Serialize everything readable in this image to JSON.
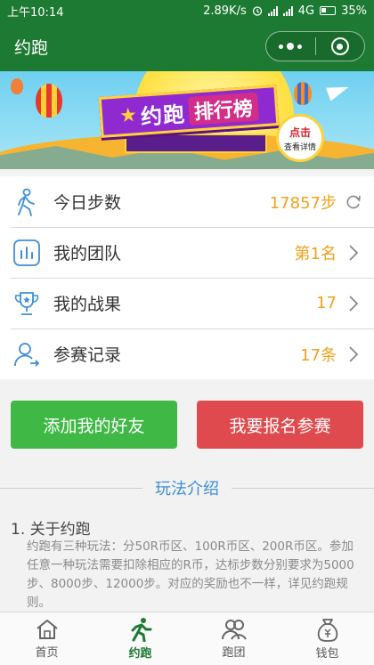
{
  "status_bar": {
    "time": "上午10:14",
    "network_speed": "2.89K/s",
    "network_type": "4G",
    "battery": "35%"
  },
  "nav": {
    "title": "约跑"
  },
  "banner": {
    "title_part1": "约跑",
    "title_part2": "排行榜",
    "badge_line1": "点击",
    "badge_line2": "查看详情"
  },
  "list": [
    {
      "label": "今日步数",
      "value": "17857步",
      "icon": "walking-person-icon",
      "action": "refresh-icon"
    },
    {
      "label": "我的团队",
      "value": "第1名",
      "icon": "bar-chart-icon",
      "action": "chevron-right-icon"
    },
    {
      "label": "我的战果",
      "value": "17",
      "icon": "trophy-icon",
      "action": "chevron-right-icon"
    },
    {
      "label": "参赛记录",
      "value": "17条",
      "icon": "user-record-icon",
      "action": "chevron-right-icon"
    }
  ],
  "buttons": {
    "add_friend": "添加我的好友",
    "signup": "我要报名参赛"
  },
  "intro": {
    "title": "玩法介绍",
    "section1_heading": "1. 关于约跑",
    "section1_text": "约跑有三种玩法：分50R币区、100R币区、200R币区。参加任意一种玩法需要扣除相应的R币，达标步数分别要求为5000步、8000步、12000步。对应的奖励也不一样，详见约跑规则。"
  },
  "tabbar": [
    {
      "label": "首页",
      "icon": "home-icon"
    },
    {
      "label": "约跑",
      "icon": "running-icon"
    },
    {
      "label": "跑团",
      "icon": "group-icon"
    },
    {
      "label": "钱包",
      "icon": "money-bag-icon"
    }
  ],
  "colors": {
    "brand_green": "#1d7a33",
    "value_orange": "#f0a21d",
    "button_green": "#40b846",
    "button_red": "#df4a4f",
    "link_blue": "#3d8fd6"
  }
}
